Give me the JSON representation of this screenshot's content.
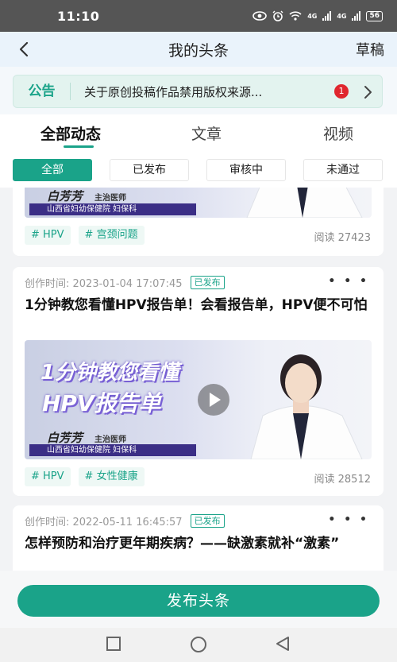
{
  "status_bar": {
    "time": "11:10",
    "net1": "4G",
    "net2": "4G",
    "battery": "56"
  },
  "header": {
    "title": "我的头条",
    "draft_label": "草稿"
  },
  "notice": {
    "tag": "公告",
    "text": "关于原创投稿作品禁用版权来源...",
    "badge": "1"
  },
  "tabs": [
    {
      "label": "全部动态",
      "active": true
    },
    {
      "label": "文章",
      "active": false
    },
    {
      "label": "视频",
      "active": false
    }
  ],
  "filters": [
    {
      "label": "全部",
      "active": true
    },
    {
      "label": "已发布",
      "active": false
    },
    {
      "label": "审核中",
      "active": false
    },
    {
      "label": "未通过",
      "active": false
    }
  ],
  "posts": [
    {
      "thumb": {
        "doctor_name": "白芳芳",
        "doctor_role": "主治医师",
        "hospital": "山西省妇幼保健院 妇保科"
      },
      "tags": [
        "# HPV",
        "# 宫颈问题"
      ],
      "reads": "阅读 27423"
    },
    {
      "created": "创作时间:  2023-01-04 17:07:45",
      "status": "已发布",
      "more": "• • •",
      "title": "1分钟教您看懂HPV报告单！会看报告单，HPV便不可怕",
      "thumb": {
        "line1": "1分钟教您看懂",
        "line2": "HPV报告单",
        "doctor_name": "白芳芳",
        "doctor_role": "主治医师",
        "hospital": "山西省妇幼保健院 妇保科"
      },
      "tags": [
        "# HPV",
        "# 女性健康"
      ],
      "reads": "阅读 28512"
    },
    {
      "created": "创作时间:  2022-05-11 16:45:57",
      "status": "已发布",
      "more": "• • •",
      "title": "怎样预防和治疗更年期疾病？——缺激素就补“激素”"
    }
  ],
  "publish_button": "发布头条",
  "colors": {
    "accent": "#1aa389",
    "badge_red": "#e0262e",
    "status_bar": "#555555"
  }
}
